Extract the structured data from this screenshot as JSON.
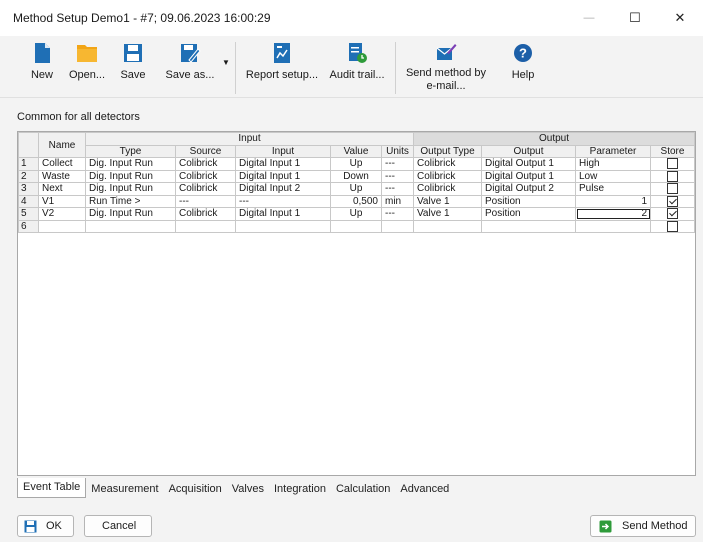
{
  "window": {
    "title": "Method Setup Demo1 - #7;  09.06.2023  16:00:29",
    "minimize_glyph": "—",
    "maximize_glyph": "☐",
    "close_glyph": "✕"
  },
  "toolbar": {
    "new_label": "New",
    "open_label": "Open...",
    "save_label": "Save",
    "save_as_label": "Save as...",
    "report_setup_label": "Report setup...",
    "audit_trail_label": "Audit trail...",
    "send_method_label_1": "Send method by",
    "send_method_label_2": "e-mail...",
    "help_label": "Help",
    "icons": [
      "new-doc-icon",
      "folder-icon",
      "floppy-disk-icon",
      "save-as-icon",
      "report-setup-icon",
      "audit-trail-icon",
      "send-email-icon",
      "help-icon"
    ]
  },
  "section_label": "Common for all detectors",
  "table": {
    "group_input": "Input",
    "group_output": "Output",
    "col_name": "Name",
    "col_type": "Type",
    "col_source": "Source",
    "col_input": "Input",
    "col_value": "Value",
    "col_units": "Units",
    "col_output_type": "Output Type",
    "col_output": "Output",
    "col_parameter": "Parameter",
    "col_store": "Store",
    "rows": [
      {
        "num": "1",
        "name": "Collect",
        "type": "Dig. Input Run",
        "source": "Colibrick",
        "input": "Digital Input 1",
        "value": "Up",
        "units": "---",
        "output_type": "Colibrick",
        "output": "Digital Output 1",
        "parameter": "High",
        "store": false
      },
      {
        "num": "2",
        "name": "Waste",
        "type": "Dig. Input Run",
        "source": "Colibrick",
        "input": "Digital Input 1",
        "value": "Down",
        "units": "---",
        "output_type": "Colibrick",
        "output": "Digital Output 1",
        "parameter": "Low",
        "store": false
      },
      {
        "num": "3",
        "name": "Next",
        "type": "Dig. Input Run",
        "source": "Colibrick",
        "input": "Digital Input 2",
        "value": "Up",
        "units": "---",
        "output_type": "Colibrick",
        "output": "Digital Output 2",
        "parameter": "Pulse",
        "store": false
      },
      {
        "num": "4",
        "name": "V1",
        "type": "Run Time >",
        "source": "---",
        "input": "---",
        "value": "0,500",
        "units": "min",
        "output_type": "Valve 1",
        "output": "Position",
        "parameter": "1",
        "store": true
      },
      {
        "num": "5",
        "name": "V2",
        "type": "Dig. Input Run",
        "source": "Colibrick",
        "input": "Digital Input 1",
        "value": "Up",
        "units": "---",
        "output_type": "Valve 1",
        "output": "Position",
        "parameter": "2",
        "store": true
      },
      {
        "num": "6",
        "name": "",
        "type": "",
        "source": "",
        "input": "",
        "value": "",
        "units": "",
        "output_type": "",
        "output": "",
        "parameter": "",
        "store": false
      }
    ]
  },
  "tabs": [
    "Event Table",
    "Measurement",
    "Acquisition",
    "Valves",
    "Integration",
    "Calculation",
    "Advanced"
  ],
  "active_tab": "Event Table",
  "footer": {
    "ok_label": "OK",
    "cancel_label": "Cancel",
    "send_method_label": "Send Method"
  },
  "colors": {
    "blue_icon": "#1f6fb5",
    "folder": "#f2a516",
    "green": "#2e9b3a",
    "help_blue": "#1c5fa8"
  }
}
